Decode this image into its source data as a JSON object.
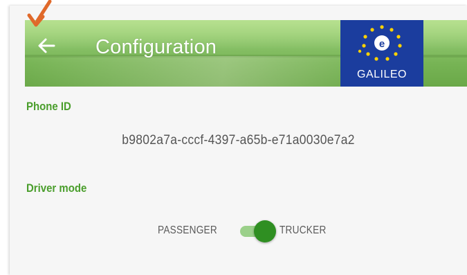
{
  "header": {
    "title": "Configuration",
    "logo_text": "GALILEO",
    "back_icon": "arrow-left-icon"
  },
  "phone_id": {
    "label": "Phone ID",
    "value": "b9802a7a-cccf-4397-a65b-e71a0030e7a2"
  },
  "driver_mode": {
    "label": "Driver mode",
    "option_off": "PASSENGER",
    "option_on": "TRUCKER",
    "selected": "TRUCKER"
  },
  "colors": {
    "accent_green": "#4a9e2c",
    "switch_thumb": "#2f8f22",
    "switch_track": "#9bd08a",
    "logo_blue": "#1b3d9e",
    "annotation_arrow": "#e0692a"
  }
}
